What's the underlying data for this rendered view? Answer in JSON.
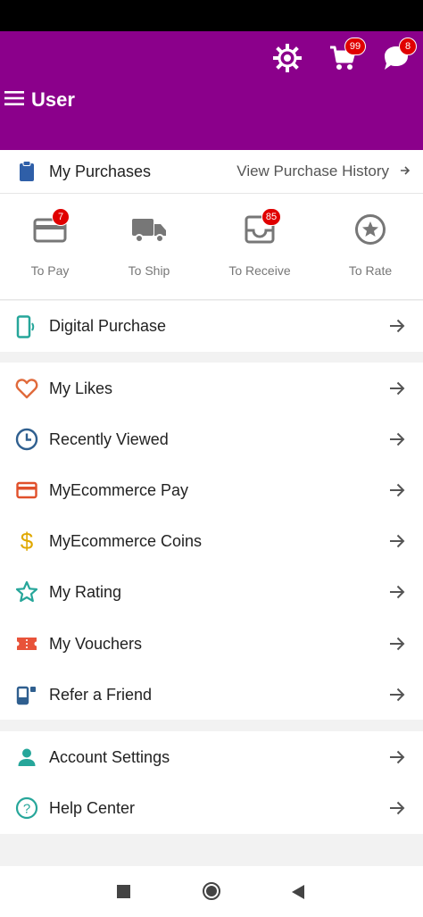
{
  "header": {
    "title": "User",
    "cart_count": "99",
    "chat_count": "8",
    "settings_icon": "gear-icon",
    "cart_icon": "cart-icon",
    "chat_icon": "chat-icon",
    "menu_icon": "hamburger-menu-icon"
  },
  "purchases": {
    "label": "My Purchases",
    "history_link": "View Purchase History",
    "orders": [
      {
        "label": "To Pay",
        "badge": "7"
      },
      {
        "label": "To Ship",
        "badge": ""
      },
      {
        "label": "To Receive",
        "badge": "85"
      },
      {
        "label": "To Rate",
        "badge": ""
      }
    ]
  },
  "digital": {
    "label": "Digital Purchase"
  },
  "menu": [
    {
      "label": "My Likes",
      "icon": "heart-icon",
      "color": "#e06a3b"
    },
    {
      "label": "Recently Viewed",
      "icon": "clock-icon",
      "color": "#2f5f8f"
    },
    {
      "label": "MyEcommerce Pay",
      "icon": "card-icon",
      "color": "#e0502b"
    },
    {
      "label": "MyEcommerce Coins",
      "icon": "dollar-icon",
      "color": "#e0a800"
    },
    {
      "label": "My Rating",
      "icon": "star-icon",
      "color": "#26a69a"
    },
    {
      "label": "My Vouchers",
      "icon": "ticket-icon",
      "color": "#e8533a"
    },
    {
      "label": "Refer a Friend",
      "icon": "refer-icon",
      "color": "#2f5f8f"
    }
  ],
  "account": [
    {
      "label": "Account Settings",
      "icon": "person-icon",
      "color": "#26a69a"
    },
    {
      "label": "Help Center",
      "icon": "help-icon",
      "color": "#26a69a"
    }
  ],
  "colors": {
    "brand": "#8b008b",
    "badge": "#e00000"
  }
}
